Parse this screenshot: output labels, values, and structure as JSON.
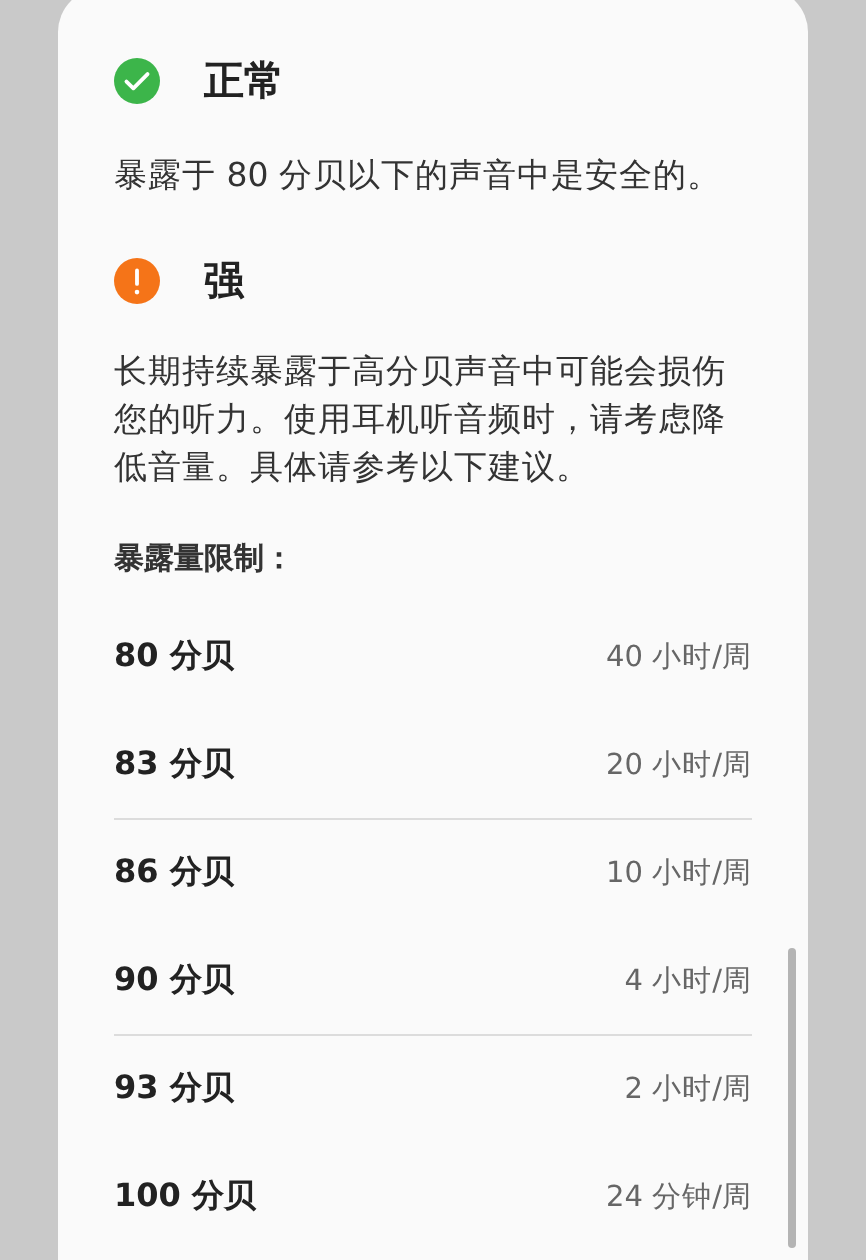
{
  "levels": [
    {
      "kind": "normal",
      "title": "正常",
      "description": "暴露于 80 分贝以下的声音中是安全的。"
    },
    {
      "kind": "warning",
      "title": "强",
      "description": "长期持续暴露于高分贝声音中可能会损伤您的听力。使用耳机听音频时，请考虑降低音量。具体请参考以下建议。"
    }
  ],
  "limits_title": "暴露量限制：",
  "limits": [
    {
      "level": "80 分贝",
      "duration": "40 小时/周",
      "divider": false
    },
    {
      "level": "83 分贝",
      "duration": "20 小时/周",
      "divider": true
    },
    {
      "level": "86 分贝",
      "duration": "10 小时/周",
      "divider": false
    },
    {
      "level": "90 分贝",
      "duration": "4 小时/周",
      "divider": true
    },
    {
      "level": "93 分贝",
      "duration": "2 小时/周",
      "divider": false
    },
    {
      "level": "100 分贝",
      "duration": "24 分钟/周",
      "divider": false
    }
  ]
}
